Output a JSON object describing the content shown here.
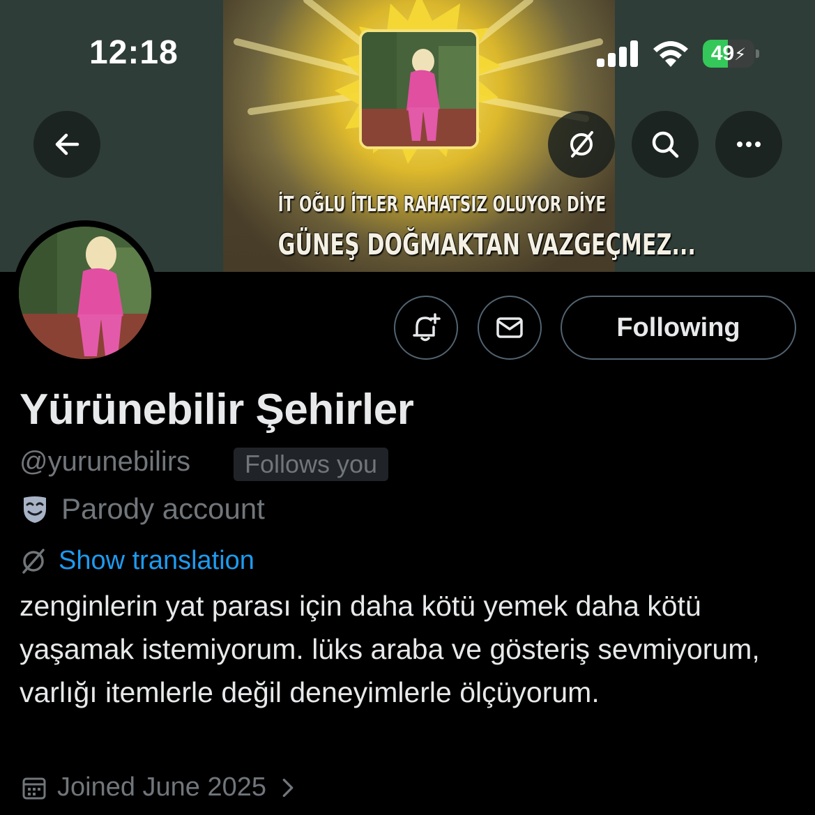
{
  "status_bar": {
    "time": "12:18",
    "battery_percent": "49",
    "battery_level": 0.49,
    "battery_color": "#34c759"
  },
  "banner": {
    "line1": "İT OĞLU İTLER RAHATSIZ OLUYOR DİYE",
    "line2": "GÜNEŞ DOĞMAKTAN VAZGEÇMEZ..."
  },
  "header_buttons": {
    "back": "arrow-left-icon",
    "translate": "translate-icon",
    "search": "search-icon",
    "more": "more-horizontal-icon"
  },
  "actions": {
    "notify": "bell-plus-icon",
    "message": "mail-icon",
    "following_label": "Following"
  },
  "profile": {
    "display_name": "Yürünebilir Şehirler",
    "handle": "@yurunebilirs",
    "follows_you": "Follows you",
    "parody_label": "Parody account",
    "show_translation": "Show translation",
    "bio": "zenginlerin yat parası için daha kötü yemek daha kötü yaşamak istemiyorum. lüks araba ve gösteriş sevmiyorum, varlığı itemlerle değil deneyimlerle ölçüyorum.",
    "joined": "Joined June 2025"
  },
  "colors": {
    "accent": "#1d9bf0",
    "muted": "#71767b",
    "text": "#e7e9ea",
    "background": "#000000",
    "border": "#536471"
  }
}
